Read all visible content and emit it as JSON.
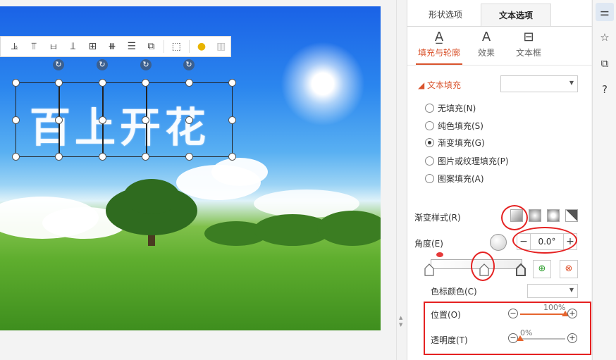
{
  "slide": {
    "wordart_text": "百上开花"
  },
  "toolbar": {
    "icons": [
      "align-bottom-left-icon",
      "align-top-icon",
      "align-vertical-center-icon",
      "align-bottom-icon",
      "distribute-grid-icon",
      "distribute-horizontal-icon",
      "distribute-vertical-icon",
      "crop-icon",
      "group-icon",
      "bulb-icon",
      "more-icon"
    ]
  },
  "panel": {
    "tabs": {
      "shape": "形状选项",
      "text": "文本选项"
    },
    "subtabs": {
      "fill": "填充与轮廓",
      "effect": "效果",
      "textbox": "文本框"
    },
    "section_title": "文本填充",
    "fill_options": [
      {
        "label": "无填充(N)",
        "selected": false
      },
      {
        "label": "纯色填充(S)",
        "selected": false
      },
      {
        "label": "渐变填充(G)",
        "selected": true
      },
      {
        "label": "图片或纹理填充(P)",
        "selected": false
      },
      {
        "label": "图案填充(A)",
        "selected": false
      }
    ],
    "gradient_style_label": "渐变样式(R)",
    "angle_label": "角度(E)",
    "angle_value": "0.0°",
    "color_label": "色标颜色(C)",
    "position_label": "位置(O)",
    "position_value": "100%",
    "position_fraction": 1.0,
    "transparency_label": "透明度(T)",
    "transparency_value": "0%",
    "transparency_fraction": 0.0
  },
  "colors": {
    "accent": "#d9532c",
    "annotation": "#e52222"
  }
}
